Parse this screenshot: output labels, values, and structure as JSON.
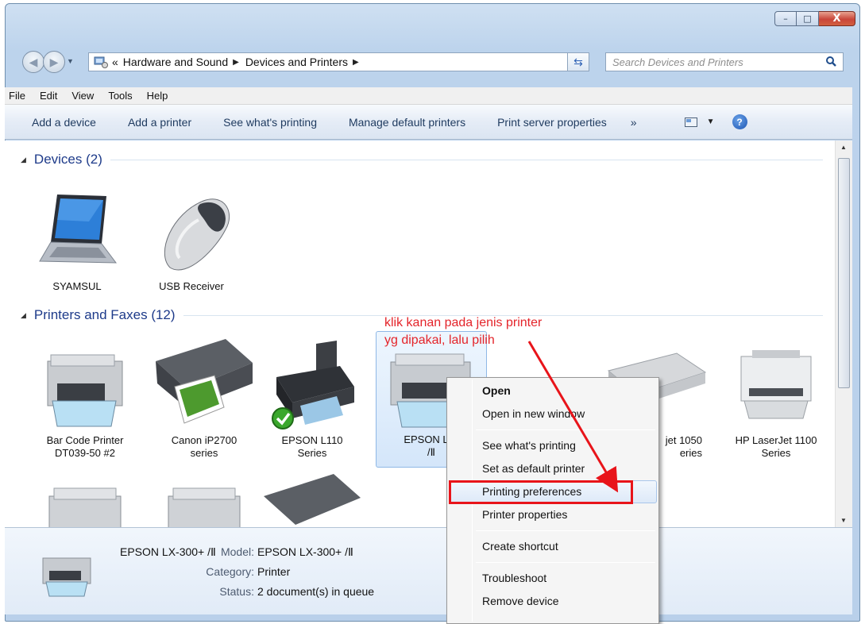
{
  "window": {
    "minimize_glyph": "–",
    "maximize_glyph": "□",
    "close_glyph": "X"
  },
  "address_bar": {
    "overflow_glyph": "«",
    "crumbs": [
      "Hardware and Sound",
      "Devices and Printers"
    ],
    "search_placeholder": "Search Devices and Printers"
  },
  "menu": [
    "File",
    "Edit",
    "View",
    "Tools",
    "Help"
  ],
  "commands": [
    "Add a device",
    "Add a printer",
    "See what's printing",
    "Manage default printers",
    "Print server properties"
  ],
  "more_glyph": "»",
  "groups": {
    "devices": {
      "title": "Devices (2)",
      "items": [
        "SYAMSUL",
        "USB Receiver"
      ]
    },
    "printers": {
      "title": "Printers and Faxes (12)",
      "items": [
        {
          "line1": "Bar Code Printer",
          "line2": "DT039-50 #2"
        },
        {
          "line1": "Canon iP2700",
          "line2": "series"
        },
        {
          "line1": "EPSON L110",
          "line2": "Series"
        },
        {
          "line1": "EPSON LX-",
          "line2": "/Ⅱ"
        },
        {
          "line1": "jet 1050",
          "line2": "eries"
        },
        {
          "line1": "HP LaserJet 1100",
          "line2": "Series"
        }
      ]
    }
  },
  "annotation": {
    "line1": "klik kanan pada jenis printer",
    "line2": "yg dipakai, lalu pilih",
    "color": "#e4242a"
  },
  "context_menu": {
    "items": [
      "Open",
      "Open in new window",
      "See what's printing",
      "Set as default printer",
      "Printing preferences",
      "Printer properties",
      "Create shortcut",
      "Troubleshoot",
      "Remove device"
    ],
    "highlighted": "Printing preferences"
  },
  "details": {
    "name": "EPSON LX-300+ /Ⅱ",
    "model_label": "Model:",
    "model": "EPSON LX-300+ /Ⅱ",
    "category_label": "Category:",
    "category": "Printer",
    "status_label": "Status:",
    "status": "2 document(s) in queue"
  }
}
